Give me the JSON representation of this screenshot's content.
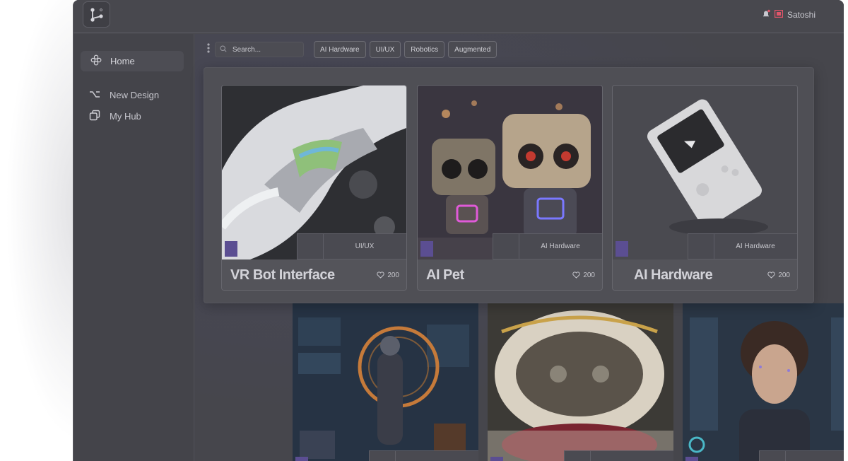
{
  "app": {
    "user": {
      "name": "Satoshi"
    }
  },
  "sidebar": {
    "items": [
      {
        "label": "Home",
        "icon": "flower-icon",
        "active": true
      },
      {
        "label": "New Design",
        "icon": "option-key-icon"
      },
      {
        "label": "My Hub",
        "icon": "copy-squares-icon"
      }
    ]
  },
  "toolbar": {
    "search_placeholder": "Search...",
    "filters": [
      "AI Hardware",
      "UI/UX",
      "Robotics",
      "Augmented"
    ]
  },
  "featured_cards": [
    {
      "title": "VR Bot Interface",
      "tag": "UI/UX",
      "likes": "200",
      "image": "white chrome robot arm"
    },
    {
      "title": "AI Pet",
      "tag": "AI Hardware",
      "likes": "200",
      "image": "two cute robots"
    },
    {
      "title": "AI Hardware",
      "tag": "AI Hardware",
      "likes": "200",
      "image": "white handheld console"
    }
  ],
  "grid_cards": [
    {
      "image": "astronaut with HUD interface"
    },
    {
      "image": "futuristic white interior"
    },
    {
      "image": "woman with digital particles"
    }
  ],
  "colors": {
    "app_bg": "#47474d",
    "accent_swatch": "#5b4e92",
    "notification": "#e0556a"
  }
}
